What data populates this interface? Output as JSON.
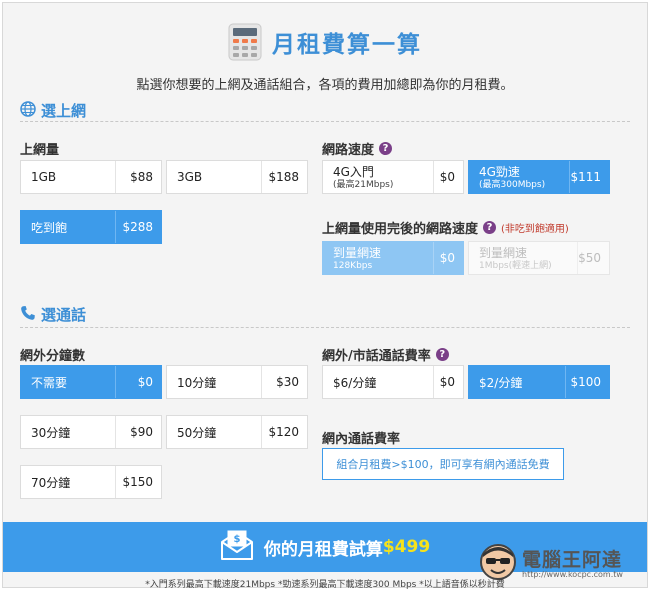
{
  "header": {
    "title": "月租費算一算",
    "subtitle": "點選你想要的上網及通話組合，各項的費用加總即為你的月租費。"
  },
  "data_section": {
    "title": "選上網",
    "usage": {
      "label": "上網量",
      "options": [
        {
          "name": "1GB",
          "price": "$88",
          "selected": false
        },
        {
          "name": "3GB",
          "price": "$188",
          "selected": false
        },
        {
          "name": "吃到飽",
          "price": "$288",
          "selected": true
        }
      ]
    },
    "speed": {
      "label": "網路速度",
      "options": [
        {
          "name": "4G入門",
          "sub": "(最高21Mbps)",
          "price": "$0",
          "selected": false
        },
        {
          "name": "4G勁速",
          "sub": "(最高300Mbps)",
          "price": "$111",
          "selected": true
        }
      ]
    },
    "after_cap": {
      "label": "上網量使用完後的網路速度",
      "note": "(非吃到飽適用)",
      "options": [
        {
          "name": "到量網速",
          "sub": "128Kbps",
          "price": "$0",
          "state": "light"
        },
        {
          "name": "到量網速",
          "sub": "1Mbps(輕速上網)",
          "price": "$50",
          "state": "dim"
        }
      ]
    }
  },
  "call_section": {
    "title": "選通話",
    "offnet": {
      "label": "網外分鐘數",
      "options": [
        {
          "name": "不需要",
          "price": "$0",
          "selected": true
        },
        {
          "name": "10分鐘",
          "price": "$30",
          "selected": false
        },
        {
          "name": "30分鐘",
          "price": "$90",
          "selected": false
        },
        {
          "name": "50分鐘",
          "price": "$120",
          "selected": false
        },
        {
          "name": "70分鐘",
          "price": "$150",
          "selected": false
        }
      ]
    },
    "landline": {
      "label": "網外/市話通話費率",
      "options": [
        {
          "name": "$6/分鐘",
          "price": "$0",
          "selected": false
        },
        {
          "name": "$2/分鐘",
          "price": "$100",
          "selected": true
        }
      ]
    },
    "onnet": {
      "label": "網內通話費率",
      "notice": "組合月租費>$100，即可享有網內通話免費"
    }
  },
  "result": {
    "label": "你的月租費試算",
    "amount": "$499"
  },
  "footnote": "*入門系列最高下載速度21Mbps *勁速系列最高下載速度300 Mbps *以上語音係以秒計費",
  "watermark": {
    "text": "電腦王阿達",
    "url": "http://www.kocpc.com.tw"
  },
  "colors": {
    "accent": "#3d9bea",
    "title_blue": "#3d8fd6",
    "amount_yellow": "#f6e21a",
    "help_purple": "#7a3f88"
  }
}
